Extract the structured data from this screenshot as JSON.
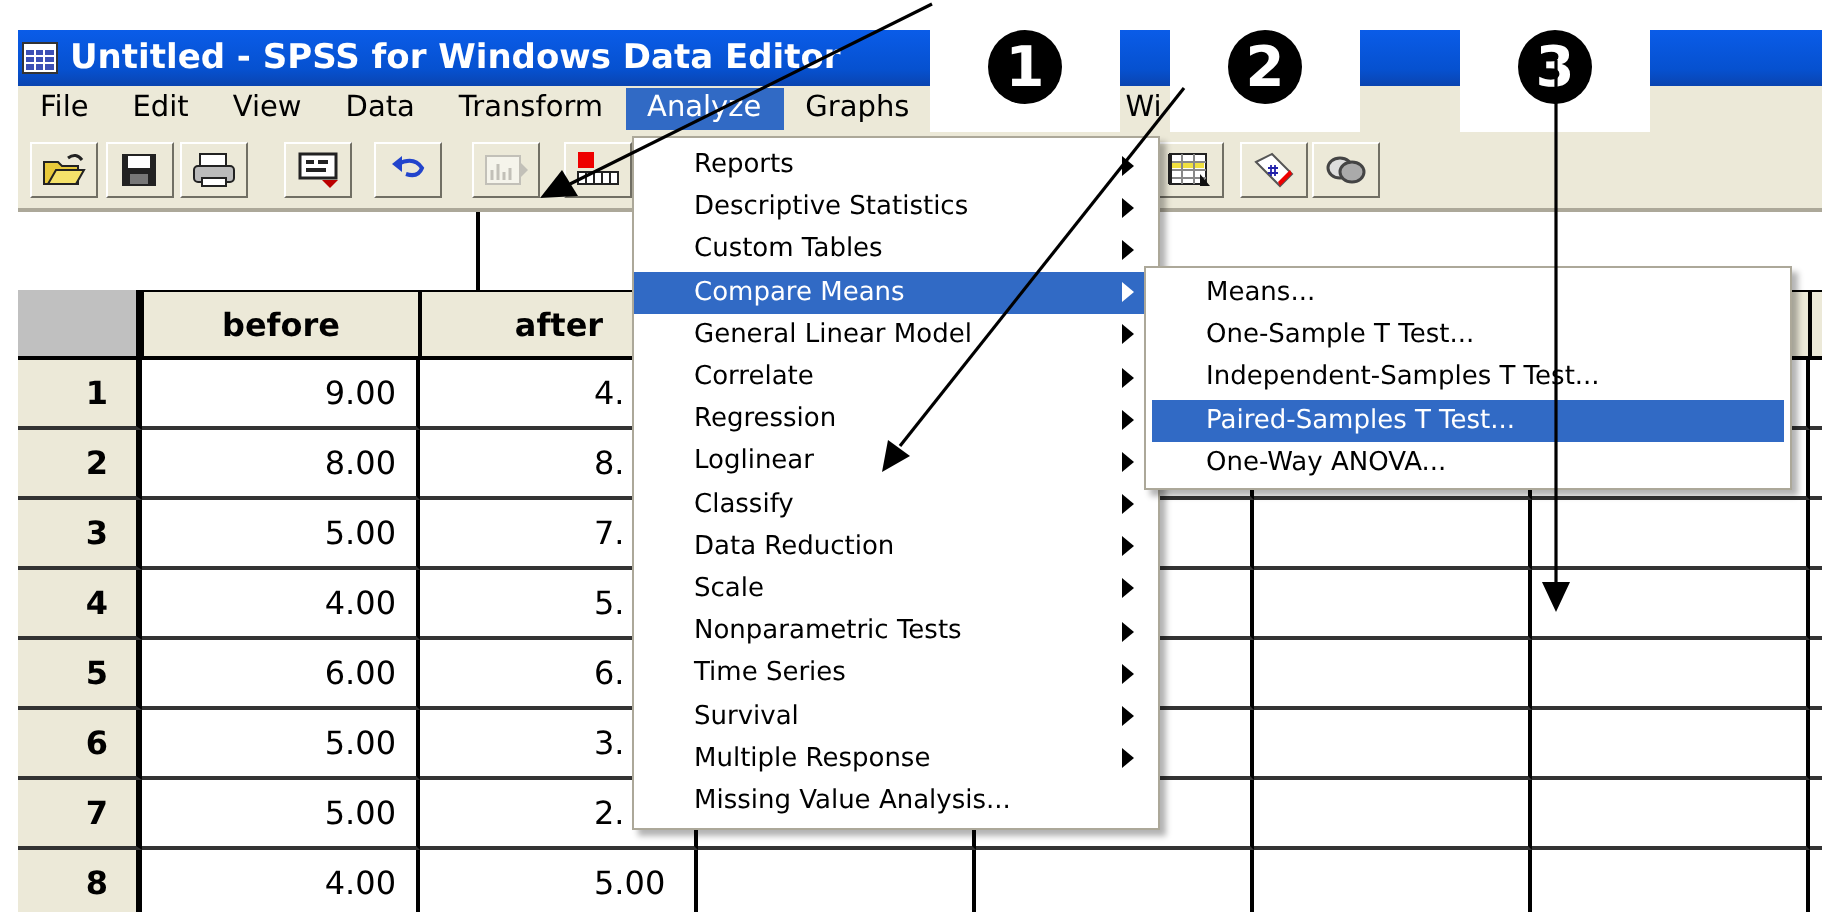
{
  "window": {
    "title": "Untitled - SPSS for Windows Data Editor"
  },
  "menu_bar": [
    {
      "label": "File",
      "selected": false
    },
    {
      "label": "Edit",
      "selected": false
    },
    {
      "label": "View",
      "selected": false
    },
    {
      "label": "Data",
      "selected": false
    },
    {
      "label": "Transform",
      "selected": false
    },
    {
      "label": "Analyze",
      "selected": true
    },
    {
      "label": "Graphs",
      "selected": false
    },
    {
      "label": "Wi",
      "selected": false
    }
  ],
  "toolbar": [
    {
      "kind": "open",
      "disabled": false
    },
    {
      "kind": "save",
      "disabled": false
    },
    {
      "kind": "print",
      "disabled": false
    },
    {
      "kind": "dialog",
      "disabled": false
    },
    {
      "kind": "undo",
      "disabled": false
    },
    {
      "kind": "chart",
      "disabled": true
    },
    {
      "kind": "goto",
      "disabled": false
    },
    {
      "kind": "grid",
      "disabled": false
    },
    {
      "kind": "tag",
      "disabled": false
    },
    {
      "kind": "sets",
      "disabled": false
    }
  ],
  "table": {
    "columns": [
      "before",
      "after"
    ],
    "rows": [
      {
        "number": "1",
        "cells": [
          "9.00",
          "4."
        ]
      },
      {
        "number": "2",
        "cells": [
          "8.00",
          "8."
        ]
      },
      {
        "number": "3",
        "cells": [
          "5.00",
          "7."
        ]
      },
      {
        "number": "4",
        "cells": [
          "4.00",
          "5."
        ]
      },
      {
        "number": "5",
        "cells": [
          "6.00",
          "6."
        ]
      },
      {
        "number": "6",
        "cells": [
          "5.00",
          "3."
        ]
      },
      {
        "number": "7",
        "cells": [
          "5.00",
          "2."
        ]
      },
      {
        "number": "8",
        "cells": [
          "4.00",
          "5.00"
        ]
      }
    ]
  },
  "analyze_menu": [
    {
      "label": "Reports",
      "submenu": true,
      "selected": false
    },
    {
      "label": "Descriptive Statistics",
      "submenu": true,
      "selected": false
    },
    {
      "label": "Custom Tables",
      "submenu": true,
      "selected": false
    },
    {
      "label": "Compare Means",
      "submenu": true,
      "selected": true
    },
    {
      "label": "General Linear Model",
      "submenu": true,
      "selected": false
    },
    {
      "label": "Correlate",
      "submenu": true,
      "selected": false
    },
    {
      "label": "Regression",
      "submenu": true,
      "selected": false
    },
    {
      "label": "Loglinear",
      "submenu": true,
      "selected": false
    },
    {
      "label": "Classify",
      "submenu": true,
      "selected": false
    },
    {
      "label": "Data Reduction",
      "submenu": true,
      "selected": false
    },
    {
      "label": "Scale",
      "submenu": true,
      "selected": false
    },
    {
      "label": "Nonparametric Tests",
      "submenu": true,
      "selected": false
    },
    {
      "label": "Time Series",
      "submenu": true,
      "selected": false
    },
    {
      "label": "Survival",
      "submenu": true,
      "selected": false
    },
    {
      "label": "Multiple Response",
      "submenu": true,
      "selected": false
    },
    {
      "label": "Missing Value Analysis...",
      "submenu": false,
      "selected": false
    }
  ],
  "compare_means_menu": [
    {
      "label": "Means...",
      "selected": false
    },
    {
      "label": "One-Sample T Test...",
      "selected": false
    },
    {
      "label": "Independent-Samples T Test...",
      "selected": false
    },
    {
      "label": "Paired-Samples T Test...",
      "selected": true
    },
    {
      "label": "One-Way ANOVA...",
      "selected": false
    }
  ],
  "step_badges": [
    "1",
    "2",
    "3"
  ]
}
